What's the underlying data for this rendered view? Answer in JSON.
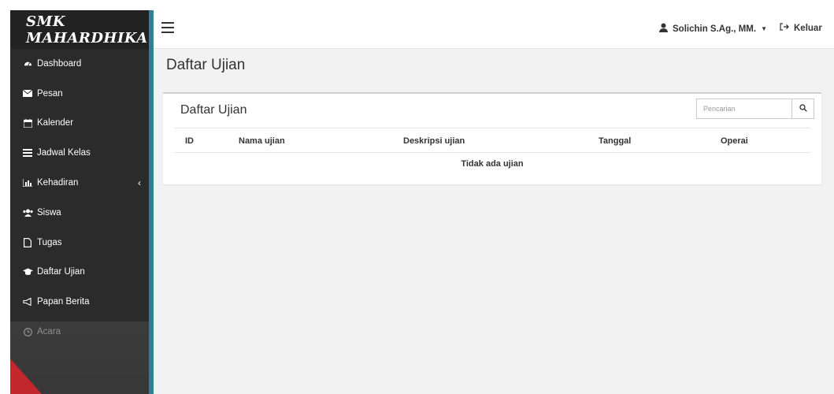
{
  "sidebar": {
    "brand": "SMK MAHARDHIKA",
    "items": [
      {
        "label": "Dashboard",
        "icon": "dashboard-icon"
      },
      {
        "label": "Pesan",
        "icon": "envelope-icon"
      },
      {
        "label": "Kalender",
        "icon": "calendar-icon"
      },
      {
        "label": "Jadwal Kelas",
        "icon": "list-icon"
      },
      {
        "label": "Kehadiran",
        "icon": "bar-chart-icon"
      },
      {
        "label": "Siswa",
        "icon": "users-icon"
      },
      {
        "label": "Tugas",
        "icon": "file-icon"
      },
      {
        "label": "Daftar Ujian",
        "icon": "graduation-cap-icon"
      },
      {
        "label": "Papan Berita",
        "icon": "bullhorn-icon"
      },
      {
        "label": "Acara",
        "icon": "clock-icon"
      }
    ]
  },
  "topbar": {
    "user_name": "Solichin S.Ag., MM.",
    "logout_label": "Keluar"
  },
  "main": {
    "page_title": "Daftar Ujian",
    "panel": {
      "title": "Daftar Ujian",
      "search_placeholder": "Pencarian",
      "columns": [
        "ID",
        "Nama ujian",
        "Deskripsi ujian",
        "Tanggal",
        "Operai"
      ],
      "empty_message": "Tidak ada ujian"
    }
  },
  "colors": {
    "sidebar_bg": "#2b2b2b",
    "sidebar_accent": "#2f7f95"
  }
}
